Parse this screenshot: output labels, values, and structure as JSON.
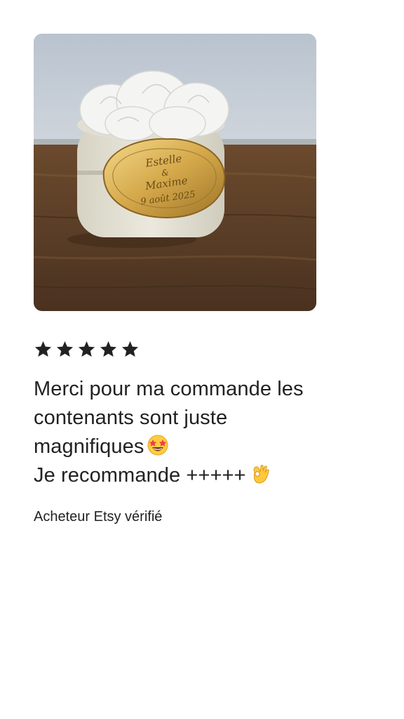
{
  "photo": {
    "alt": "Boîte à fleurs blanche avec plaque dorée",
    "plaque_line_1": "Estelle",
    "plaque_line_2": "&",
    "plaque_line_3": "Maxime",
    "plaque_line_4": "9 août 2025"
  },
  "rating": {
    "stars": 5,
    "max": 5
  },
  "review": {
    "line_1": "Merci pour ma commande les",
    "line_2": "contenants sont juste",
    "line_3": "magnifiques",
    "line_4": "Je recommande +++++"
  },
  "icons": {
    "star": "star-icon",
    "emoji_1": "star-struck-emoji",
    "emoji_2": "ok-hand-emoji"
  },
  "buyer": {
    "label": "Acheteur Etsy vérifié"
  },
  "colors": {
    "text": "#222222",
    "background": "#ffffff",
    "star": "#222222",
    "gold": "#d4a84a"
  }
}
